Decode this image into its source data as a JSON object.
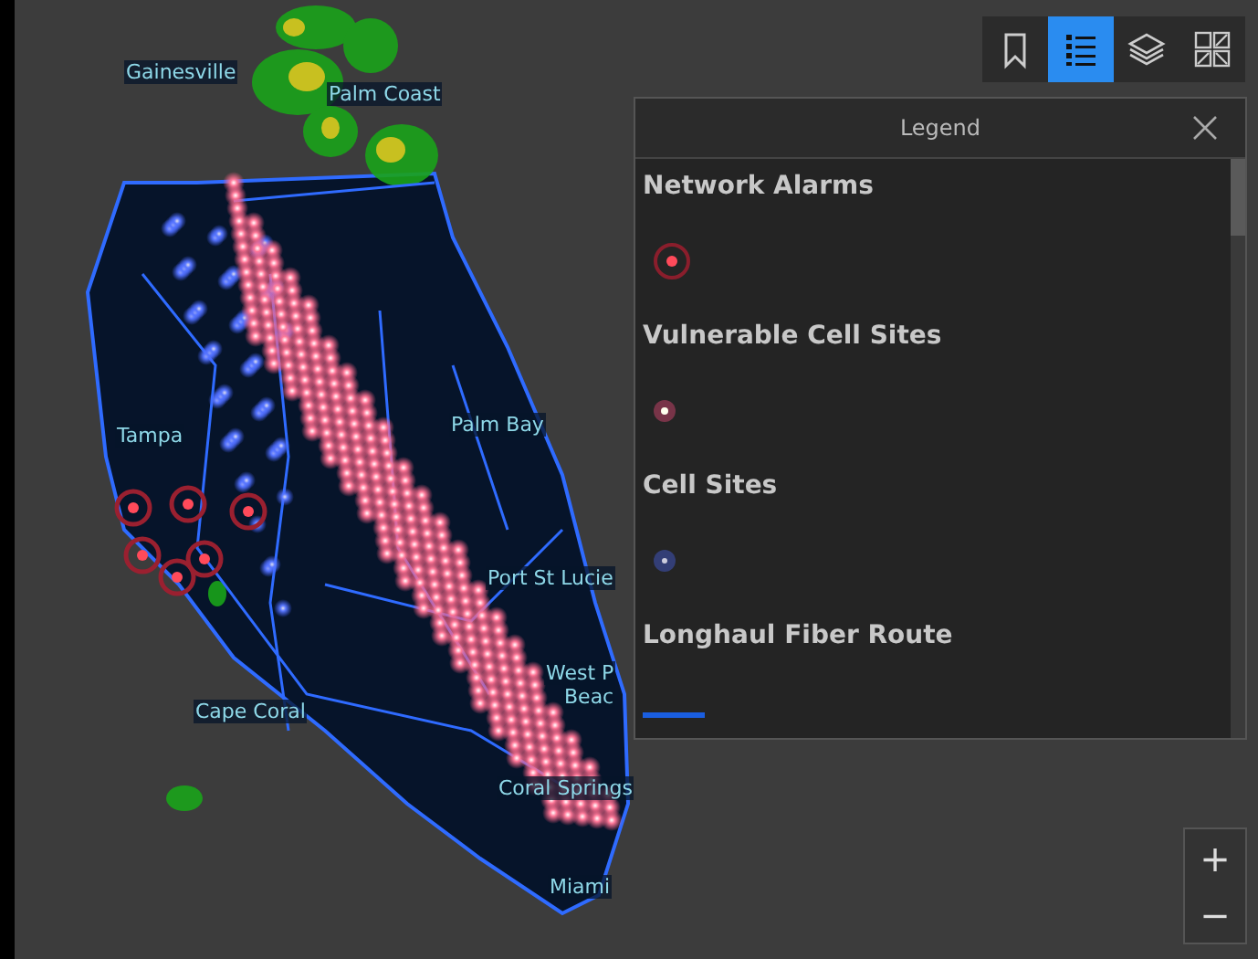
{
  "map": {
    "labels": [
      "Gainesville",
      "Palm Coast",
      "Tampa",
      "Palm Bay",
      "Port St Lucie",
      "West P",
      "Beac",
      "Cape Coral",
      "Coral Springs",
      "Miami"
    ]
  },
  "toolbar": [
    {
      "kind": "bookmark",
      "selected": false
    },
    {
      "kind": "legend",
      "selected": true
    },
    {
      "kind": "layers",
      "selected": false
    },
    {
      "kind": "basemap",
      "selected": false
    }
  ],
  "legend": {
    "title": "Legend",
    "items": [
      {
        "label": "Network Alarms",
        "kind": "alarm"
      },
      {
        "label": "Vulnerable Cell Sites",
        "kind": "vulnerable"
      },
      {
        "label": "Cell Sites",
        "kind": "cell"
      },
      {
        "label": "Longhaul Fiber Route",
        "kind": "line"
      }
    ]
  },
  "zoom": [
    "+",
    "−"
  ]
}
